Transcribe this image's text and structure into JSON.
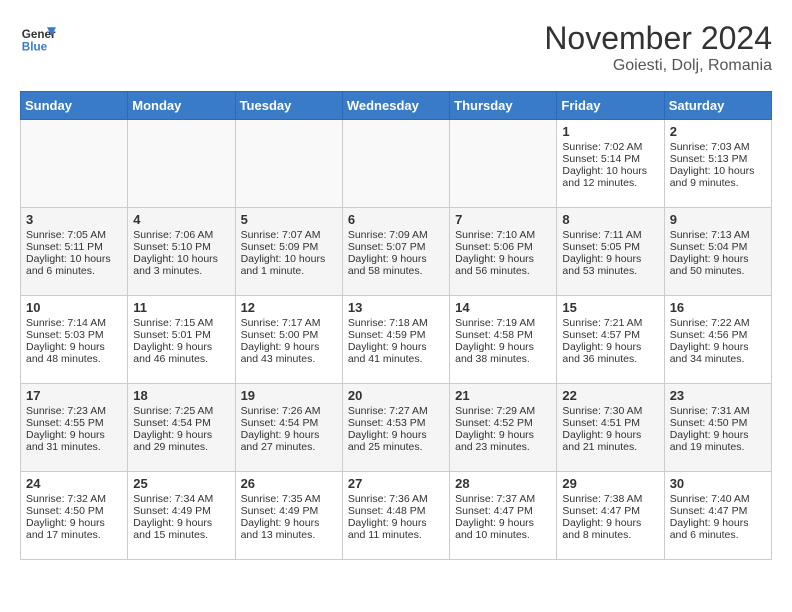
{
  "header": {
    "logo_line1": "General",
    "logo_line2": "Blue",
    "month": "November 2024",
    "location": "Goiesti, Dolj, Romania"
  },
  "weekdays": [
    "Sunday",
    "Monday",
    "Tuesday",
    "Wednesday",
    "Thursday",
    "Friday",
    "Saturday"
  ],
  "weeks": [
    [
      {
        "day": "",
        "info": ""
      },
      {
        "day": "",
        "info": ""
      },
      {
        "day": "",
        "info": ""
      },
      {
        "day": "",
        "info": ""
      },
      {
        "day": "",
        "info": ""
      },
      {
        "day": "1",
        "info": "Sunrise: 7:02 AM\nSunset: 5:14 PM\nDaylight: 10 hours and 12 minutes."
      },
      {
        "day": "2",
        "info": "Sunrise: 7:03 AM\nSunset: 5:13 PM\nDaylight: 10 hours and 9 minutes."
      }
    ],
    [
      {
        "day": "3",
        "info": "Sunrise: 7:05 AM\nSunset: 5:11 PM\nDaylight: 10 hours and 6 minutes."
      },
      {
        "day": "4",
        "info": "Sunrise: 7:06 AM\nSunset: 5:10 PM\nDaylight: 10 hours and 3 minutes."
      },
      {
        "day": "5",
        "info": "Sunrise: 7:07 AM\nSunset: 5:09 PM\nDaylight: 10 hours and 1 minute."
      },
      {
        "day": "6",
        "info": "Sunrise: 7:09 AM\nSunset: 5:07 PM\nDaylight: 9 hours and 58 minutes."
      },
      {
        "day": "7",
        "info": "Sunrise: 7:10 AM\nSunset: 5:06 PM\nDaylight: 9 hours and 56 minutes."
      },
      {
        "day": "8",
        "info": "Sunrise: 7:11 AM\nSunset: 5:05 PM\nDaylight: 9 hours and 53 minutes."
      },
      {
        "day": "9",
        "info": "Sunrise: 7:13 AM\nSunset: 5:04 PM\nDaylight: 9 hours and 50 minutes."
      }
    ],
    [
      {
        "day": "10",
        "info": "Sunrise: 7:14 AM\nSunset: 5:03 PM\nDaylight: 9 hours and 48 minutes."
      },
      {
        "day": "11",
        "info": "Sunrise: 7:15 AM\nSunset: 5:01 PM\nDaylight: 9 hours and 46 minutes."
      },
      {
        "day": "12",
        "info": "Sunrise: 7:17 AM\nSunset: 5:00 PM\nDaylight: 9 hours and 43 minutes."
      },
      {
        "day": "13",
        "info": "Sunrise: 7:18 AM\nSunset: 4:59 PM\nDaylight: 9 hours and 41 minutes."
      },
      {
        "day": "14",
        "info": "Sunrise: 7:19 AM\nSunset: 4:58 PM\nDaylight: 9 hours and 38 minutes."
      },
      {
        "day": "15",
        "info": "Sunrise: 7:21 AM\nSunset: 4:57 PM\nDaylight: 9 hours and 36 minutes."
      },
      {
        "day": "16",
        "info": "Sunrise: 7:22 AM\nSunset: 4:56 PM\nDaylight: 9 hours and 34 minutes."
      }
    ],
    [
      {
        "day": "17",
        "info": "Sunrise: 7:23 AM\nSunset: 4:55 PM\nDaylight: 9 hours and 31 minutes."
      },
      {
        "day": "18",
        "info": "Sunrise: 7:25 AM\nSunset: 4:54 PM\nDaylight: 9 hours and 29 minutes."
      },
      {
        "day": "19",
        "info": "Sunrise: 7:26 AM\nSunset: 4:54 PM\nDaylight: 9 hours and 27 minutes."
      },
      {
        "day": "20",
        "info": "Sunrise: 7:27 AM\nSunset: 4:53 PM\nDaylight: 9 hours and 25 minutes."
      },
      {
        "day": "21",
        "info": "Sunrise: 7:29 AM\nSunset: 4:52 PM\nDaylight: 9 hours and 23 minutes."
      },
      {
        "day": "22",
        "info": "Sunrise: 7:30 AM\nSunset: 4:51 PM\nDaylight: 9 hours and 21 minutes."
      },
      {
        "day": "23",
        "info": "Sunrise: 7:31 AM\nSunset: 4:50 PM\nDaylight: 9 hours and 19 minutes."
      }
    ],
    [
      {
        "day": "24",
        "info": "Sunrise: 7:32 AM\nSunset: 4:50 PM\nDaylight: 9 hours and 17 minutes."
      },
      {
        "day": "25",
        "info": "Sunrise: 7:34 AM\nSunset: 4:49 PM\nDaylight: 9 hours and 15 minutes."
      },
      {
        "day": "26",
        "info": "Sunrise: 7:35 AM\nSunset: 4:49 PM\nDaylight: 9 hours and 13 minutes."
      },
      {
        "day": "27",
        "info": "Sunrise: 7:36 AM\nSunset: 4:48 PM\nDaylight: 9 hours and 11 minutes."
      },
      {
        "day": "28",
        "info": "Sunrise: 7:37 AM\nSunset: 4:47 PM\nDaylight: 9 hours and 10 minutes."
      },
      {
        "day": "29",
        "info": "Sunrise: 7:38 AM\nSunset: 4:47 PM\nDaylight: 9 hours and 8 minutes."
      },
      {
        "day": "30",
        "info": "Sunrise: 7:40 AM\nSunset: 4:47 PM\nDaylight: 9 hours and 6 minutes."
      }
    ]
  ]
}
